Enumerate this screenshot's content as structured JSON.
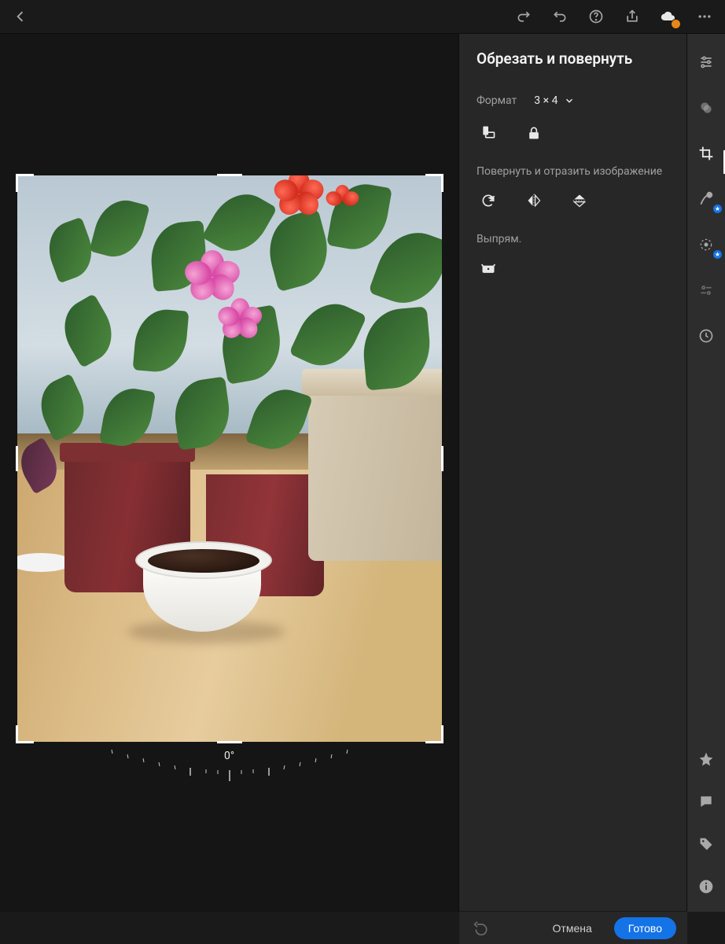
{
  "topbar": {
    "back_icon": "chevron-left",
    "redo_icon": "redo",
    "undo_icon": "undo",
    "help_icon": "help",
    "share_icon": "share",
    "cloud_icon": "cloud-sync",
    "more_icon": "more"
  },
  "panel": {
    "title": "Обрезать и повернуть",
    "aspect_label": "Формат",
    "aspect_value": "3 × 4",
    "rotate_label": "Повернуть и отразить изображение",
    "straighten_label": "Выпрям."
  },
  "angle": {
    "value": "0°"
  },
  "bottom": {
    "cancel": "Отмена",
    "done": "Готово"
  },
  "toolstrip": {
    "adjust": "adjust-sliders",
    "presets": "presets",
    "crop": "crop",
    "heal": "healing-brush",
    "mask": "masking",
    "autosettings": "auto-settings",
    "versions": "versions",
    "star": "star",
    "comment": "comment",
    "tag": "tag",
    "info": "info"
  }
}
